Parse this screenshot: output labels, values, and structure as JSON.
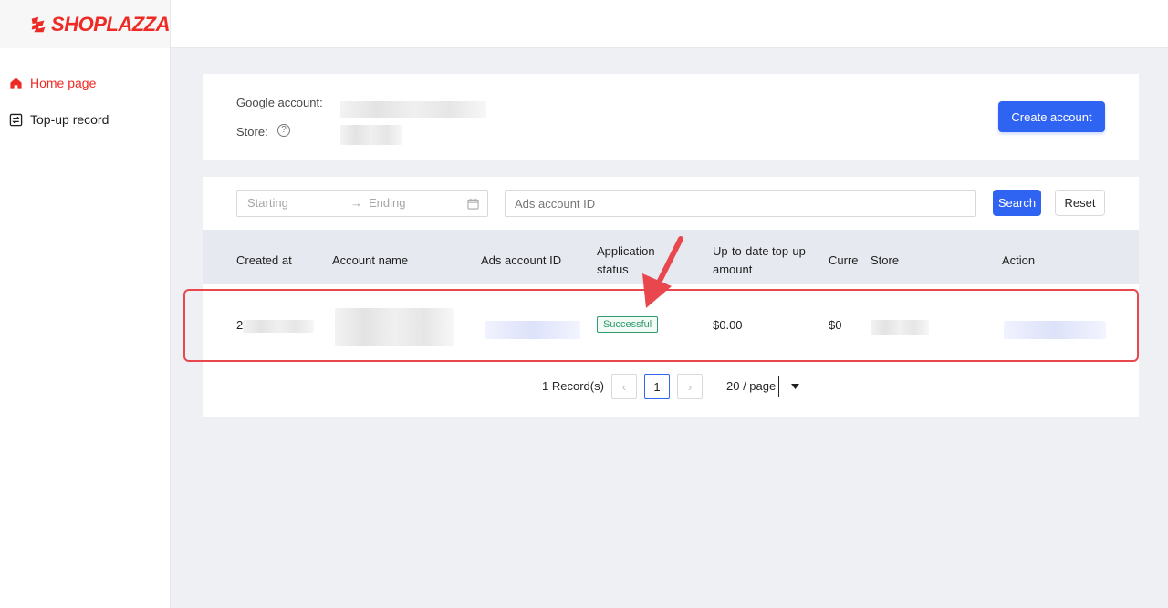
{
  "brand": {
    "name": "SHOPLAZZA",
    "color": "#ee2a24"
  },
  "sidebar": {
    "items": [
      {
        "label": "Home page",
        "icon": "home-icon",
        "active": true
      },
      {
        "label": "Top-up record",
        "icon": "record-icon",
        "active": false
      }
    ]
  },
  "account_info": {
    "google_label": "Google account:",
    "store_label": "Store:",
    "create_button": "Create account"
  },
  "filters": {
    "start_placeholder": "Starting",
    "end_placeholder": "Ending",
    "ads_id_placeholder": "Ads account ID",
    "search_button": "Search",
    "reset_button": "Reset"
  },
  "table": {
    "columns": [
      "Created at",
      "Account name",
      "Ads account ID",
      "Application status",
      "Up-to-date top-up amount",
      "Curre",
      "Store",
      "Action"
    ],
    "rows": [
      {
        "created_at_prefix": "2",
        "status": "Successful",
        "topup_amount": "$0.00",
        "currency_amount": "$0"
      }
    ]
  },
  "pagination": {
    "records": "1 Record(s)",
    "current_page": "1",
    "page_size": "20 / page"
  },
  "colors": {
    "accent": "#2f63f2",
    "success": "#2f9a6b",
    "highlight": "#e8474d"
  }
}
